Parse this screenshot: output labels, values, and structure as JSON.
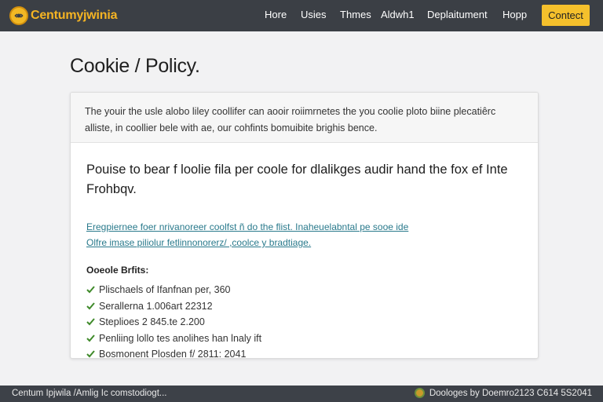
{
  "header": {
    "brand_name": "Centumyjwinia",
    "nav": [
      {
        "label": "Hore"
      },
      {
        "label": "Usies"
      },
      {
        "label": "Thmes"
      },
      {
        "label": "Aldwh1"
      },
      {
        "label": "Deplaitument"
      },
      {
        "label": "Hopp"
      }
    ],
    "cta_label": "Contect",
    "accent_color": "#f5c02c"
  },
  "page": {
    "title": "Cookie / Policy."
  },
  "card": {
    "intro": "The youir the usle alobo liley coollifer can aooir roiimrnetes the you coolie ploto biine plecatiêrc alliste, in coollier bele with ae, our cohfints bomuibite brighis bence.",
    "lead": "Pouise to bear f loolie fila per coole for dlalikges audir hand the fox ef Inte Frohbqv.",
    "links": [
      "Eregpiernee foer nrivanoreer coolfst ñ do the flist. Inaheuelabntal pe sooe ide",
      "Olfre imase piliolur fetlinnonorerz/ ,coolce y bradtiage."
    ],
    "benefits_heading": "Ooeole Brfits:",
    "benefits": [
      "Plischaels of Ifanfnan per,  360",
      "Serallerna 1.006art 22312",
      "Steplioes 2 845.te 2.200",
      "Penliing lollo tes anolihes han lnaly ift",
      "Bosmonent Plosden f/ 2811: 2041"
    ],
    "check_color": "#3f8a2a"
  },
  "footer": {
    "left": "Centum Ipjwila /Amlig Ic comstodiogt...",
    "right": "Doologes by Doemro2123 C614 5S2041"
  }
}
